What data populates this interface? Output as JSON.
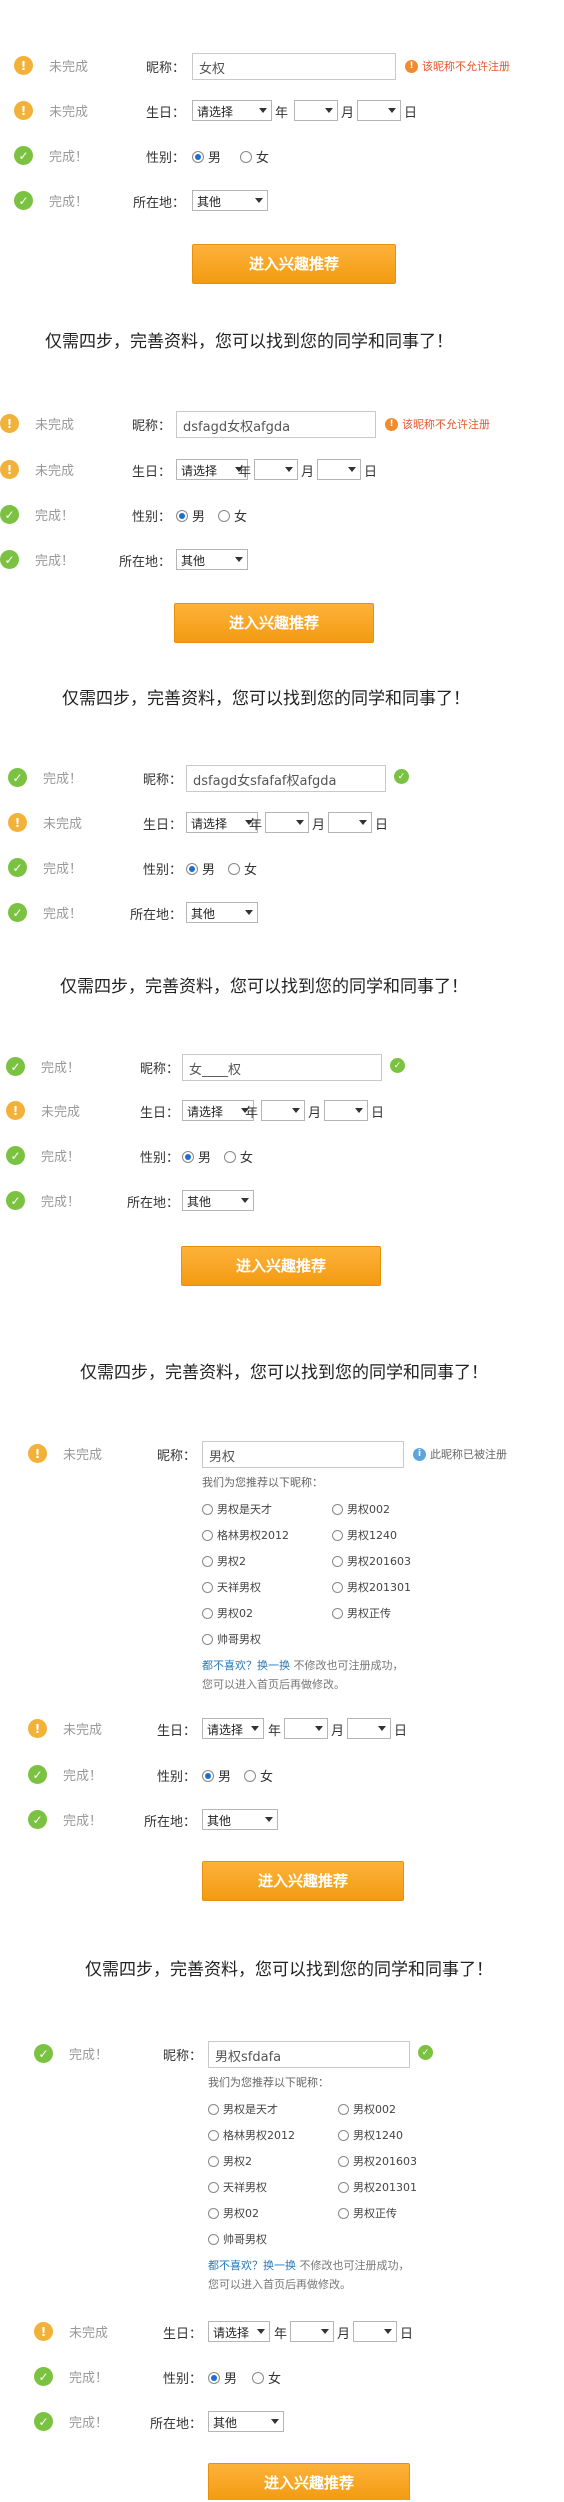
{
  "status": {
    "incomplete": "未完成",
    "complete": "完成！"
  },
  "labels": {
    "nickname": "昵称：",
    "birthday": "生日：",
    "gender": "性别：",
    "location": "所在地：",
    "year": "年",
    "month": "月",
    "day": "日"
  },
  "options": {
    "select_placeholder": "请选择",
    "male": "男",
    "female": "女",
    "location_value": "其他"
  },
  "submit_label": "进入兴趣推荐",
  "headline": "仅需四步，完善资料，您可以找到您的同学和同事了！",
  "panels": [
    {
      "nickname_value": "女权",
      "tip": "该昵称不允许注册"
    },
    {
      "nickname_value": "dsfagd女权afgda",
      "tip": "该昵称不允许注册"
    },
    {
      "nickname_value": "dsfagd女sfafaf权afgda"
    },
    {
      "nickname_value": "女____权"
    },
    {
      "nickname_value": "男权",
      "tip": "此昵称已被注册"
    },
    {
      "nickname_value": "男权sfdafa"
    }
  ],
  "suggestions": {
    "title": "我们为您推荐以下昵称：",
    "names": [
      "男权是天才",
      "男权002",
      "格林男权2012",
      "男权1240",
      "男权2",
      "男权201603",
      "天祥男权",
      "男权201301",
      "男权02",
      "男权正传",
      "帅哥男权"
    ],
    "note_link": "都不喜欢？换一换",
    "note_rest": "不修改也可注册成功，",
    "note_line2": "您可以进入首页后再做修改。"
  },
  "colors": {
    "warning": "#f2b23a",
    "complete": "#7cc242",
    "error": "#e4572e",
    "button": "#f7a928"
  },
  "icons": {
    "warning": "exclamation-circle-icon",
    "complete": "check-circle-icon",
    "info": "info-circle-icon",
    "dropdown": "caret-down-icon"
  }
}
